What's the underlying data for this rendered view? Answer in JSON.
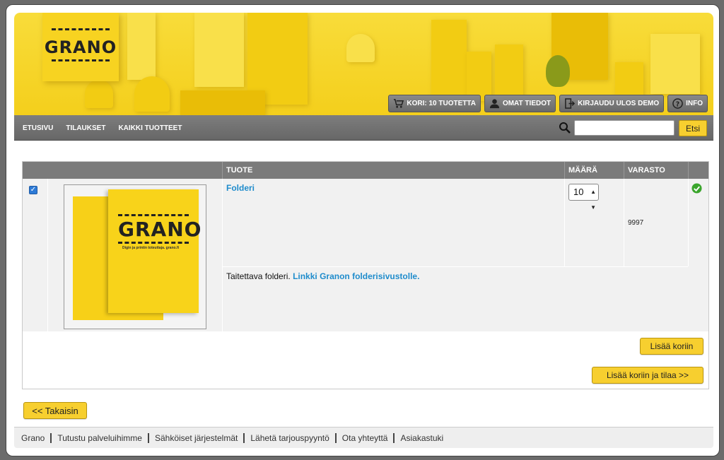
{
  "header": {
    "logo_text": "GRANO",
    "buttons": {
      "cart": "KORI: 10 TUOTETTA",
      "profile": "OMAT TIEDOT",
      "logout": "KIRJAUDU ULOS DEMO",
      "info": "INFO"
    }
  },
  "nav": {
    "links": [
      "ETUSIVU",
      "TILAUKSET",
      "KAIKKI TUOTTEET"
    ],
    "search_value": "",
    "search_button": "Etsi"
  },
  "table": {
    "headers": [
      "TUOTE",
      "MÄÄRÄ",
      "VARASTO"
    ],
    "product": {
      "name": "Folderi",
      "quantity": "10",
      "stock": "9997",
      "description": "Taitettava folderi.",
      "link_text": "Linkki Granon folderisivustolle.",
      "thumb_logo": "GRANO",
      "thumb_subtitle": "Digin ja printin toteuttaja. grano.fi",
      "checked": true
    }
  },
  "actions": {
    "add_to_cart": "Lisää koriin",
    "add_and_order": "Lisää koriin ja tilaa >>",
    "back": "<< Takaisin"
  },
  "footer": {
    "links": [
      "Grano",
      "Tutustu palveluihimme",
      "Sähköiset järjestelmät",
      "Lähetä tarjouspyyntö",
      "Ota yhteyttä",
      "Asiakastuki"
    ]
  },
  "colors": {
    "brand_yellow": "#f7cf2f",
    "nav_gray": "#707070",
    "link_blue": "#1f8ccc"
  }
}
